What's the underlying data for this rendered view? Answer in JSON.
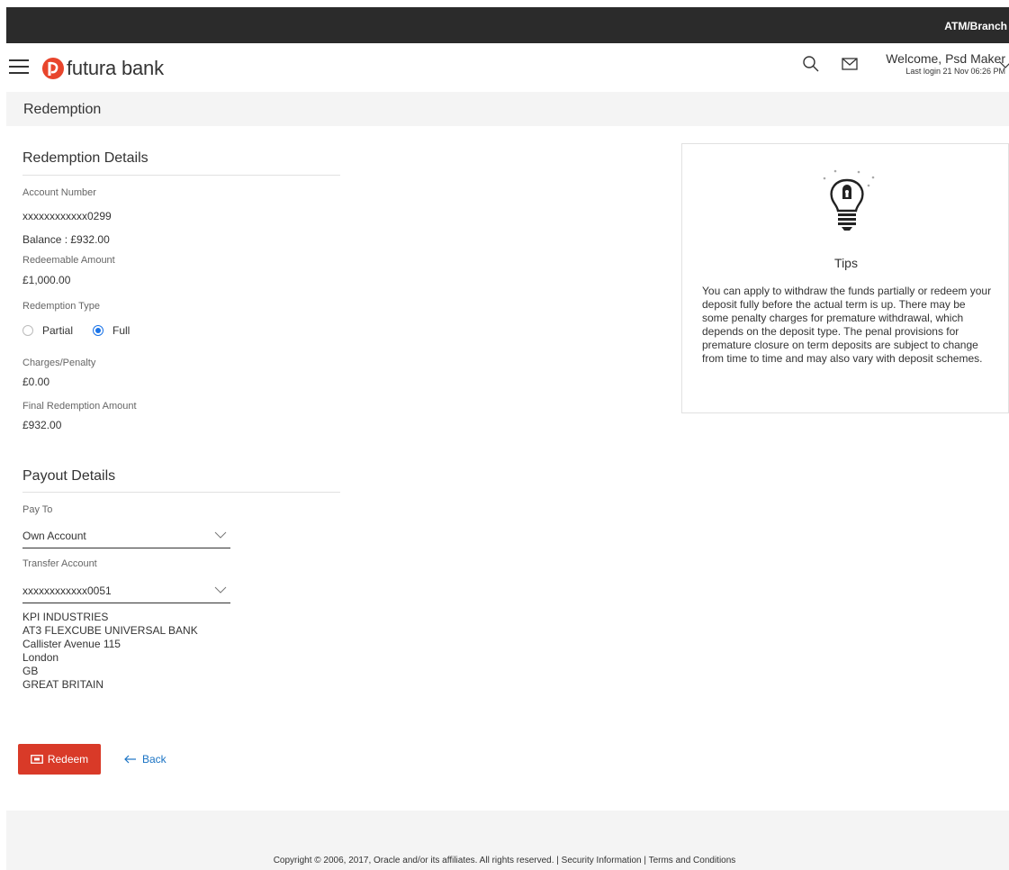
{
  "topbar": {
    "location_link": "ATM/Branch"
  },
  "header": {
    "brand": "futura bank",
    "welcome": "Welcome, Psd Maker",
    "last_login": "Last login 21 Nov 06:26 PM"
  },
  "page_title": "Redemption",
  "redemption": {
    "section_title": "Redemption Details",
    "account_number_label": "Account Number",
    "account_number": "xxxxxxxxxxxx0299",
    "balance": "Balance : £932.00",
    "redeemable_label": "Redeemable Amount",
    "redeemable_amount": "£1,000.00",
    "type_label": "Redemption Type",
    "type_options": [
      "Partial",
      "Full"
    ],
    "type_selected": "Full",
    "charges_label": "Charges/Penalty",
    "charges_value": "£0.00",
    "final_label": "Final Redemption Amount",
    "final_value": "£932.00"
  },
  "payout": {
    "section_title": "Payout Details",
    "pay_to_label": "Pay To",
    "pay_to_value": "Own Account",
    "transfer_label": "Transfer Account",
    "transfer_value": "xxxxxxxxxxxx0051",
    "address": [
      "KPI INDUSTRIES",
      "AT3 FLEXCUBE UNIVERSAL BANK",
      "Callister Avenue 115",
      "London",
      "GB",
      "GREAT BRITAIN"
    ]
  },
  "actions": {
    "redeem": "Redeem",
    "back": "Back"
  },
  "tips": {
    "title": "Tips",
    "text": "You can apply to withdraw the funds partially or redeem your deposit fully before the actual term is up. There may be some penalty charges for premature withdrawal, which depends on the deposit type. The penal provisions for premature closure on term deposits are subject to change from time to time and may also vary with deposit schemes."
  },
  "footer": {
    "copyright": "Copyright © 2006, 2017, Oracle and/or its affiliates. All rights reserved.",
    "sep": " | ",
    "security": "Security Information",
    "terms": "Terms and Conditions"
  },
  "colors": {
    "primary_button": "#d93a28",
    "link": "#1a73c4",
    "radio_selected": "#1a73e8",
    "topbar": "#2b2b2b"
  },
  "icons": [
    "hamburger-icon",
    "futura-logo-icon",
    "search-icon",
    "mail-icon",
    "chevron-down-icon",
    "lightbulb-icon",
    "redeem-icon",
    "back-arrow-icon"
  ]
}
